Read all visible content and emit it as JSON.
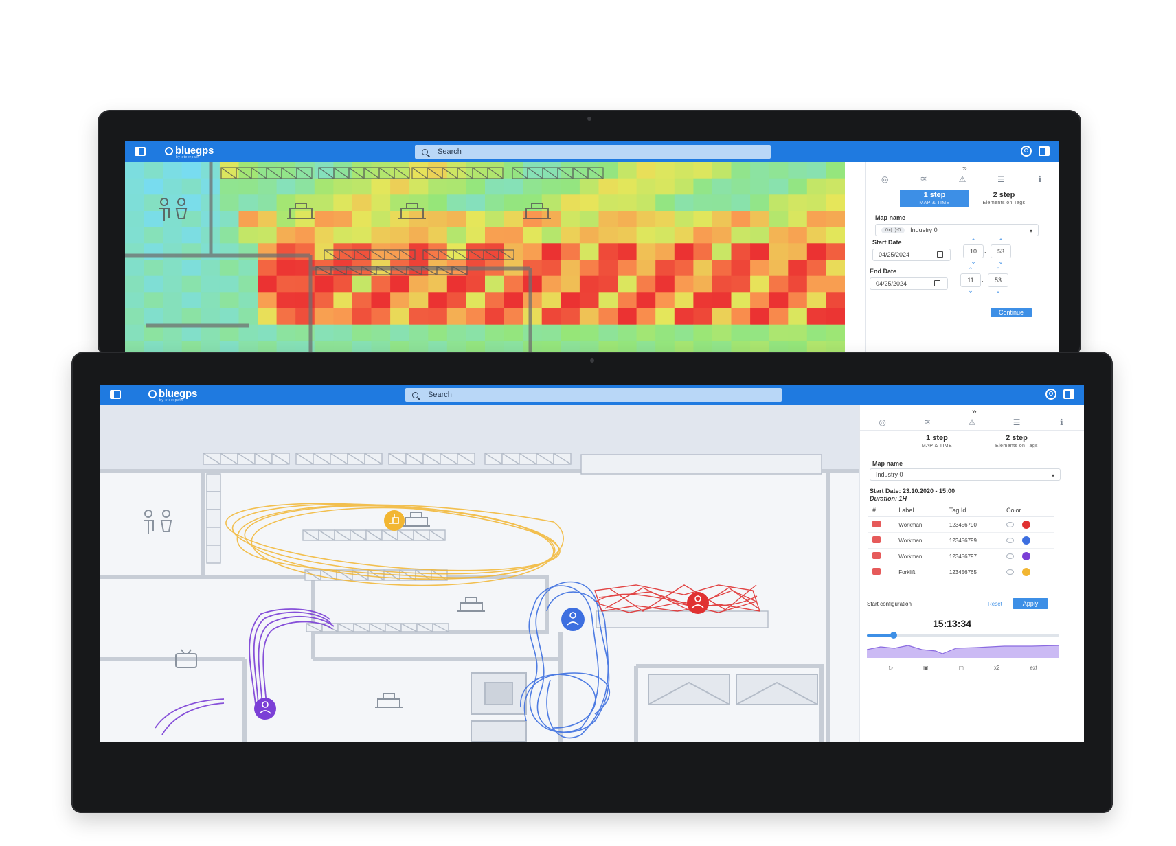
{
  "colors": {
    "topbar": "#1f7ae0",
    "accent": "#3d8fe6",
    "workman_red": "#e03131",
    "workman_blue": "#3d6fe0",
    "workman_purple": "#7b3fd6",
    "forklift_yellow": "#f2b632"
  },
  "back_screen": {
    "app": {
      "logo": "bluegps",
      "logo_tagline": "by steerpath"
    },
    "search": {
      "placeholder": "Search"
    },
    "map": {
      "type": "heatmap",
      "icons": [
        "restroom-icon",
        "workstation-icon",
        "shelving-icon"
      ]
    },
    "panel": {
      "tools": [
        "location-icon",
        "layers-icon",
        "warning-icon",
        "filters-icon",
        "info-icon"
      ],
      "steps": [
        {
          "label": "1 step",
          "sub": "MAP & TIME",
          "active": true
        },
        {
          "label": "2 step",
          "sub": "Elements on Tags",
          "active": false
        }
      ],
      "map_name_label": "Map name",
      "map_name_value": "Industry 0",
      "map_name_chip": "0x(..)-0",
      "start_date_label": "Start Date",
      "start_date_value": "04/25/2024",
      "start_hour": "10",
      "start_min": "53",
      "end_date_label": "End Date",
      "end_date_value": "04/25/2024",
      "end_hour": "11",
      "end_min": "53",
      "continue": "Continue"
    }
  },
  "front_screen": {
    "app": {
      "logo": "bluegps",
      "logo_tagline": "by steerpath"
    },
    "search": {
      "placeholder": "Search"
    },
    "panel": {
      "tools": [
        "location-icon",
        "layers-icon",
        "warning-icon",
        "filters-icon",
        "info-icon"
      ],
      "steps": [
        {
          "label": "1 step",
          "sub": "MAP & TIME",
          "active": false
        },
        {
          "label": "2 step",
          "sub": "Elements on Tags",
          "active": false
        }
      ],
      "map_name_label": "Map name",
      "map_name_value": "Industry 0",
      "start_date_text": "Start Date: 23.10.2020 - 15:00",
      "duration_text": "Duration: 1H",
      "table": {
        "headers": [
          "#",
          "Label",
          "Tag Id",
          "Color"
        ],
        "rows": [
          {
            "label": "Workman",
            "tag_id": "123456790",
            "color": "#e03131"
          },
          {
            "label": "Workman",
            "tag_id": "123456799",
            "color": "#3d6fe0"
          },
          {
            "label": "Workman",
            "tag_id": "123456797",
            "color": "#7b3fd6"
          },
          {
            "label": "Forklift",
            "tag_id": "123456765",
            "color": "#f2b632"
          }
        ]
      },
      "start_configuration": "Start configuration",
      "reset": "Reset",
      "apply": "Apply",
      "player_time": "15:13:34",
      "player_progress": 0.14,
      "controls": [
        "play-icon",
        "stop-icon",
        "frame-icon",
        "x2",
        "ext"
      ]
    }
  }
}
